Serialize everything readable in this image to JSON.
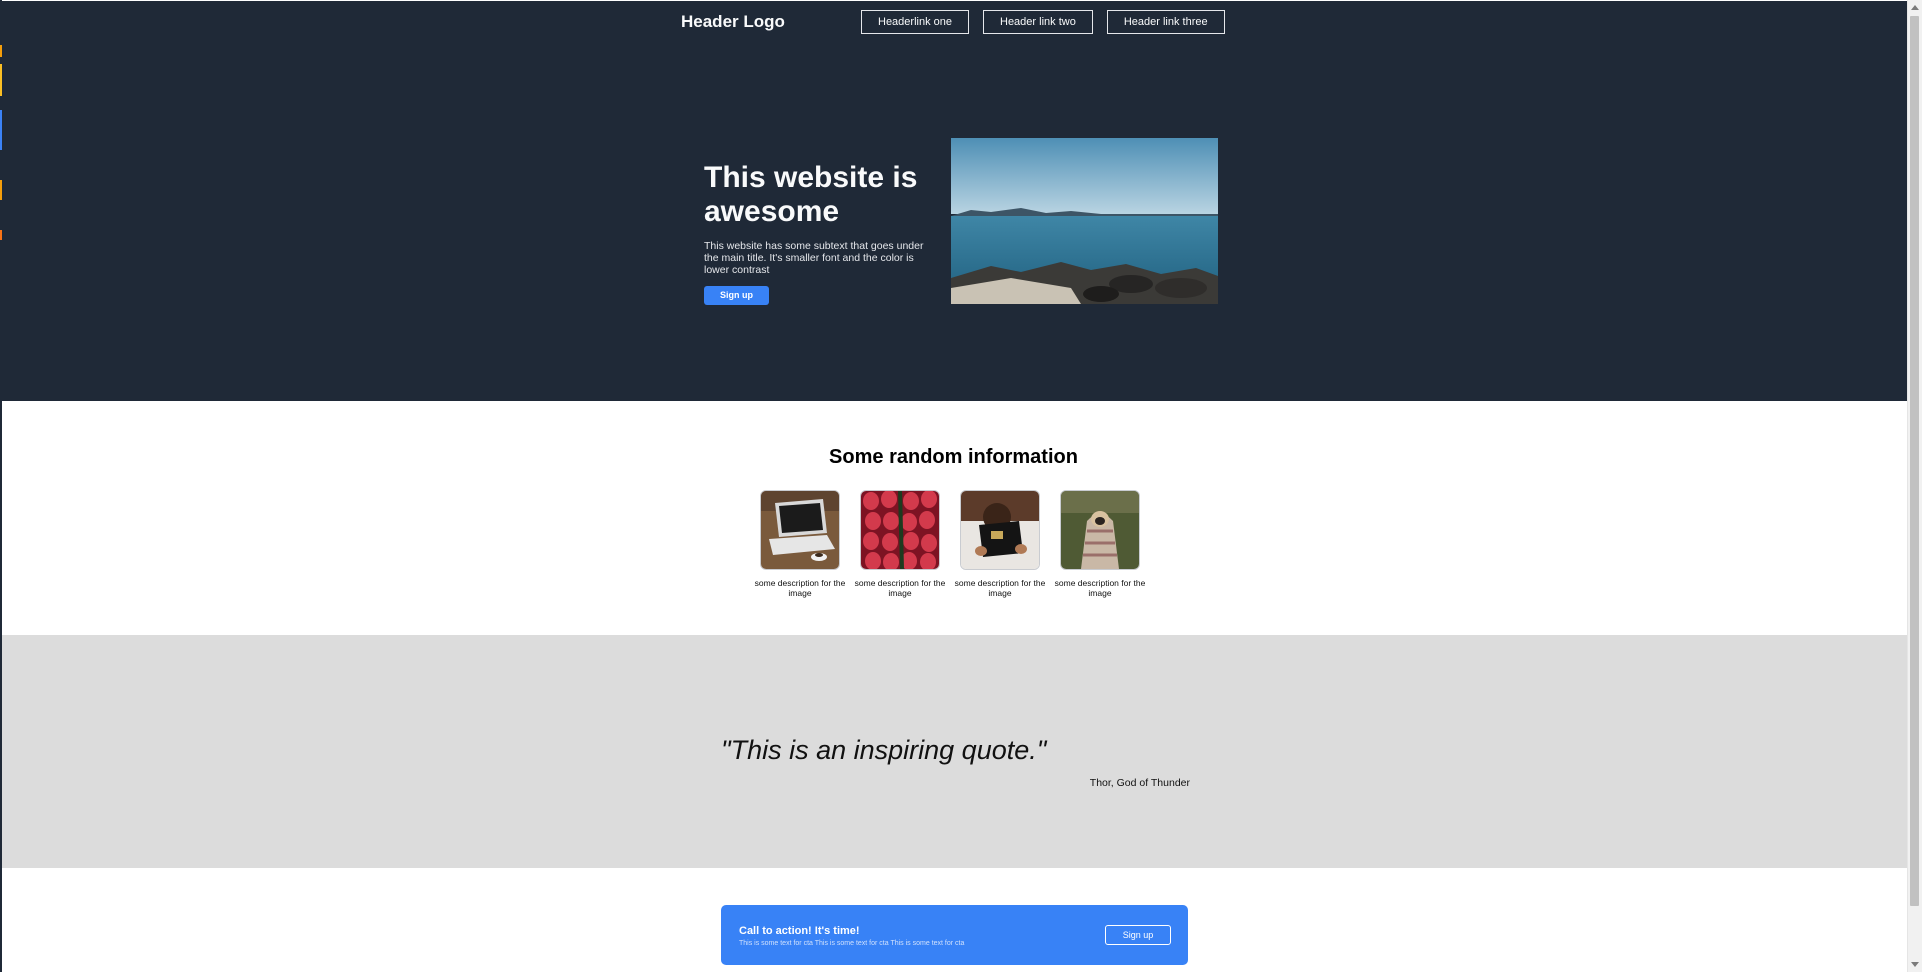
{
  "header": {
    "logo": "Header Logo",
    "links": [
      "Headerlink one",
      "Header link two",
      "Header link three"
    ]
  },
  "hero": {
    "title": "This website is awesome",
    "subtext": "This website has some subtext that goes under the main title. It's smaller font and the color is lower contrast",
    "button_label": "Sign up",
    "image_icon": "lake-rocks-photo"
  },
  "info": {
    "title": "Some random information",
    "cards": [
      {
        "icon": "laptop-photo",
        "caption": "some description for the image"
      },
      {
        "icon": "strawberries-photo",
        "caption": "some description for the image"
      },
      {
        "icon": "reading-book-photo",
        "caption": "some description for the image"
      },
      {
        "icon": "pug-blanket-photo",
        "caption": "some description for the image"
      }
    ]
  },
  "quote": {
    "text": "\"This is an inspiring quote.\"",
    "author": "Thor, God of Thunder"
  },
  "cta": {
    "title": "Call to action! It's time!",
    "subtext": "This is some text for cta This is some text for cta This is some text for cta",
    "button_label": "Sign up"
  },
  "colors": {
    "dark_bg": "#1f2937",
    "accent_blue": "#3882f6",
    "quote_bg": "#dcdcdc"
  }
}
